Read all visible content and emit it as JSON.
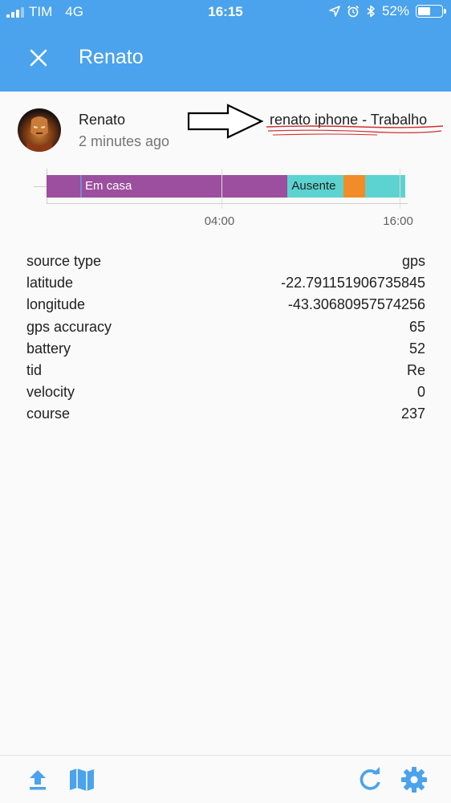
{
  "statusbar": {
    "carrier": "TIM",
    "network": "4G",
    "time": "16:15",
    "battery_text": "52%",
    "battery_level": 0.52,
    "icons": [
      "location-arrow-icon",
      "alarm-icon",
      "bluetooth-icon",
      "battery-icon"
    ]
  },
  "header": {
    "title": "Renato",
    "close_icon": "close-icon"
  },
  "entity": {
    "name": "Renato",
    "last_seen": "2 minutes ago"
  },
  "annotation": {
    "device_name": "renato iphone - Trabalho",
    "arrow_icon": "right-arrow-icon",
    "underline_color": "#d32f2f"
  },
  "timeline": {
    "segments": [
      {
        "label": "Em casa",
        "start": 0.0,
        "end": 0.672,
        "color": "#9b4f9e"
      },
      {
        "label": "Ausente",
        "start": 0.672,
        "end": 0.827,
        "color": "#5cd3d0"
      },
      {
        "label": "",
        "start": 0.827,
        "end": 0.888,
        "color": "#f28c28"
      },
      {
        "label": "",
        "start": 0.888,
        "end": 1.0,
        "color": "#5cd3d0"
      }
    ],
    "ticks": [
      {
        "label": "04:00",
        "pos": 0.487
      },
      {
        "label": "16:00",
        "pos": 0.985
      }
    ]
  },
  "attributes": [
    {
      "key": "source type",
      "value": "gps"
    },
    {
      "key": "latitude",
      "value": "-22.791151906735845"
    },
    {
      "key": "longitude",
      "value": "-43.30680957574256"
    },
    {
      "key": "gps accuracy",
      "value": "65"
    },
    {
      "key": "battery",
      "value": "52"
    },
    {
      "key": "tid",
      "value": "Re"
    },
    {
      "key": "velocity",
      "value": "0"
    },
    {
      "key": "course",
      "value": "237"
    }
  ],
  "bottombar": {
    "left_icons": [
      "upload-icon",
      "map-icon"
    ],
    "right_icons": [
      "refresh-icon",
      "settings-icon"
    ],
    "accent_color": "#4aa3ec"
  },
  "colors": {
    "primary": "#4aa3ec",
    "background": "#fafafa"
  }
}
